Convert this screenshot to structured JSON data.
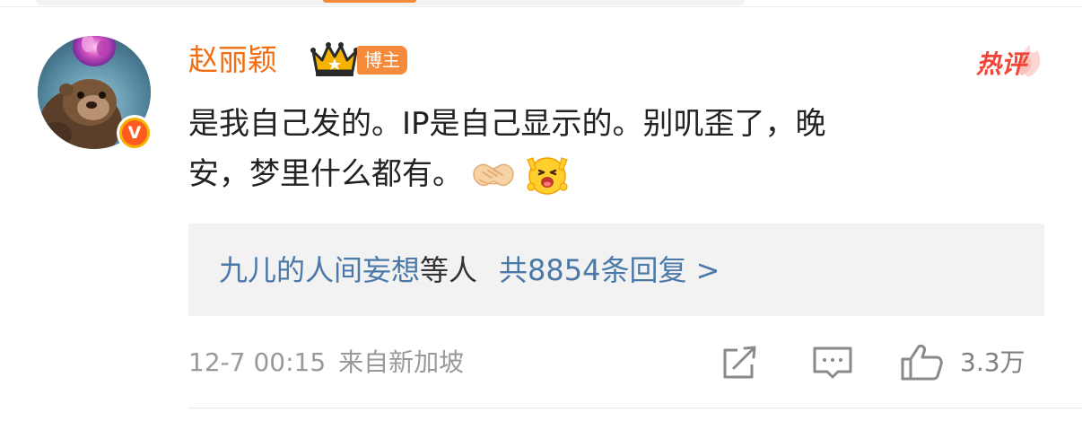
{
  "comment": {
    "author": {
      "name": "赵丽颖",
      "badge_label": "博主",
      "verified_mark": "V"
    },
    "hot_label": "热评",
    "text_line1": "是我自己发的。IP是自己显示的。别叽歪了，晚",
    "text_line2": "安，梦里什么都有。",
    "emoji_names": [
      "handshake-emoji",
      "yeah-emoji"
    ],
    "replies": {
      "users": "九儿的人间妄想",
      "suffix": "等人",
      "count_text": "共8854条回复 >"
    },
    "timestamp": "12-7 00:15",
    "source": "来自新加坡",
    "like_count": "3.3万"
  },
  "colors": {
    "username": "#f26d11",
    "badge_bg": "#f58a3a",
    "hot": "#f24438",
    "link": "#4a78a8",
    "meta": "#999999",
    "reply_bg": "#f2f2f2"
  }
}
